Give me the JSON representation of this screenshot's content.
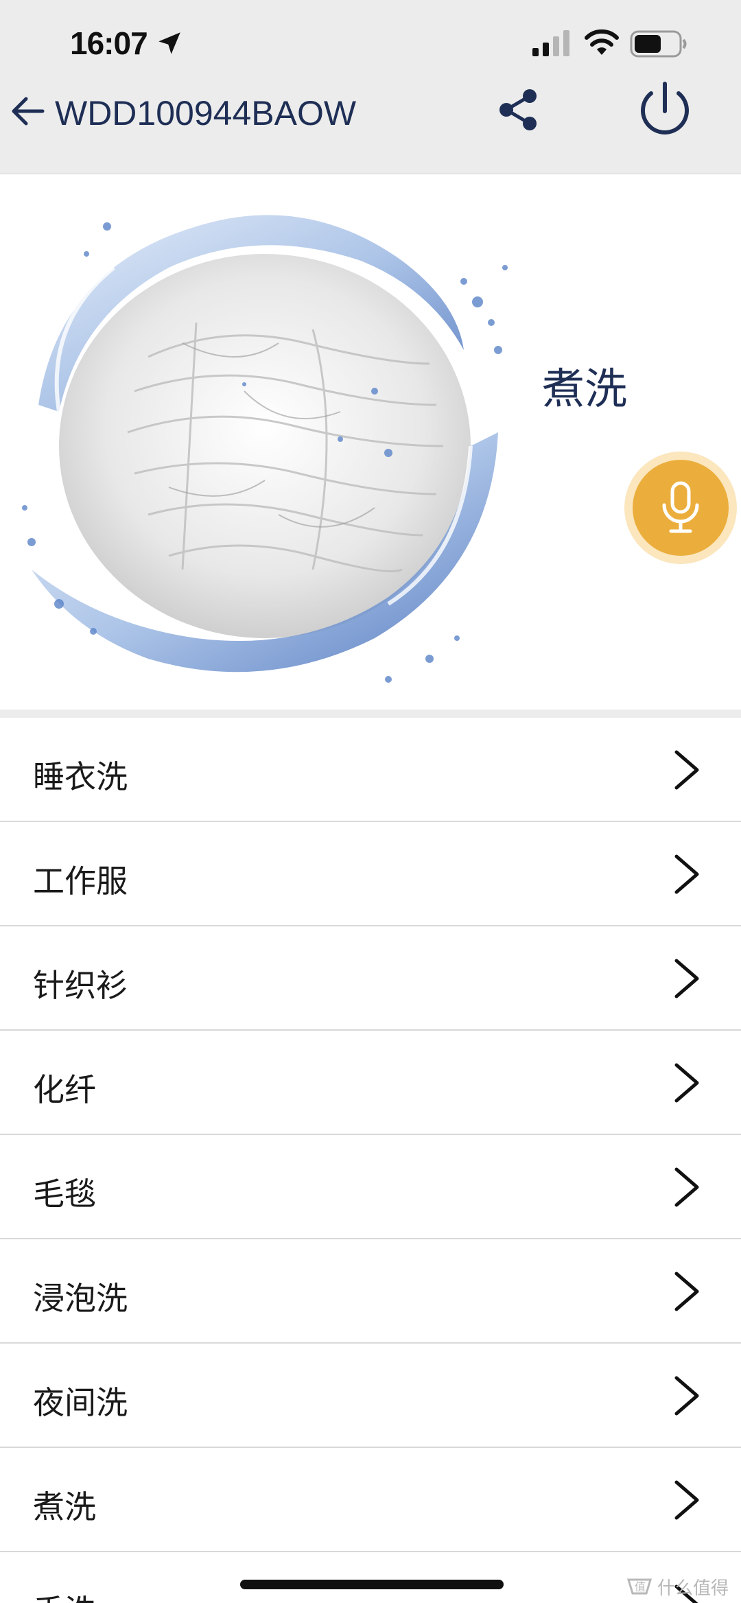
{
  "status_bar": {
    "time": "16:07"
  },
  "header": {
    "title": "WDD100944BAOW"
  },
  "hero": {
    "current_mode": "煮洗"
  },
  "programs": [
    {
      "label": "睡衣洗"
    },
    {
      "label": "工作服"
    },
    {
      "label": "针织衫"
    },
    {
      "label": "化纤"
    },
    {
      "label": "毛毯"
    },
    {
      "label": "浸泡洗"
    },
    {
      "label": "夜间洗"
    },
    {
      "label": "煮洗"
    },
    {
      "label": "手洗"
    }
  ],
  "watermark": {
    "text": "什么值得买"
  },
  "colors": {
    "brand_navy": "#1e2e55",
    "mic_accent": "#ebae3c",
    "header_bg": "#ececec"
  },
  "icons": {
    "back": "arrow-left-icon",
    "share": "share-icon",
    "power": "power-icon",
    "mic": "microphone-icon",
    "chevron": "chevron-right-icon"
  }
}
